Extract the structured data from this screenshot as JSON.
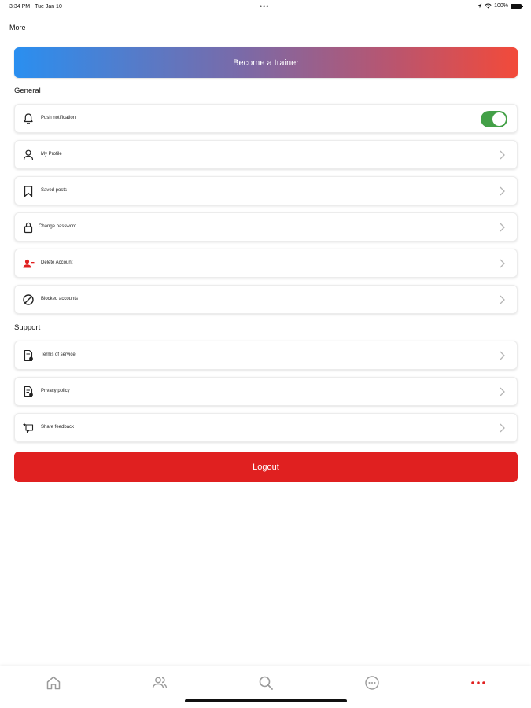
{
  "status_bar": {
    "time": "3:34 PM",
    "date": "Tue Jan 10",
    "center_dots": "•••",
    "battery_text": "100%"
  },
  "header": {
    "title": "More"
  },
  "become_trainer": {
    "label": "Become a trainer"
  },
  "general": {
    "title": "General",
    "items": [
      {
        "label": "Push notification",
        "icon": "bell-icon",
        "control": "toggle",
        "on": true
      },
      {
        "label": "My Profile",
        "icon": "person-icon",
        "control": "chevron"
      },
      {
        "label": "Saved posts",
        "icon": "bookmark-icon",
        "control": "chevron"
      },
      {
        "label": "Change password",
        "icon": "lock-icon",
        "control": "chevron"
      },
      {
        "label": "Delete Account",
        "icon": "delete-user-icon",
        "control": "chevron"
      },
      {
        "label": "Blocked accounts",
        "icon": "blocked-icon",
        "control": "chevron"
      }
    ]
  },
  "support": {
    "title": "Support",
    "items": [
      {
        "label": "Terms of service",
        "icon": "document-icon",
        "control": "chevron"
      },
      {
        "label": "Privacy policy",
        "icon": "document-icon",
        "control": "chevron"
      },
      {
        "label": "Share feedback",
        "icon": "feedback-icon",
        "control": "chevron"
      }
    ]
  },
  "logout": {
    "label": "Logout"
  },
  "tab_bar": {
    "tabs": [
      {
        "icon": "home-icon",
        "active": false
      },
      {
        "icon": "people-icon",
        "active": false
      },
      {
        "icon": "search-icon",
        "active": false
      },
      {
        "icon": "chat-icon",
        "active": false
      },
      {
        "icon": "more-icon",
        "active": true
      }
    ]
  },
  "colors": {
    "accent_red": "#e02020",
    "toggle_green": "#43a047",
    "gradient_start": "#2a8ff0",
    "gradient_end": "#f24a3a",
    "inactive_icon": "#9a9a9a"
  }
}
